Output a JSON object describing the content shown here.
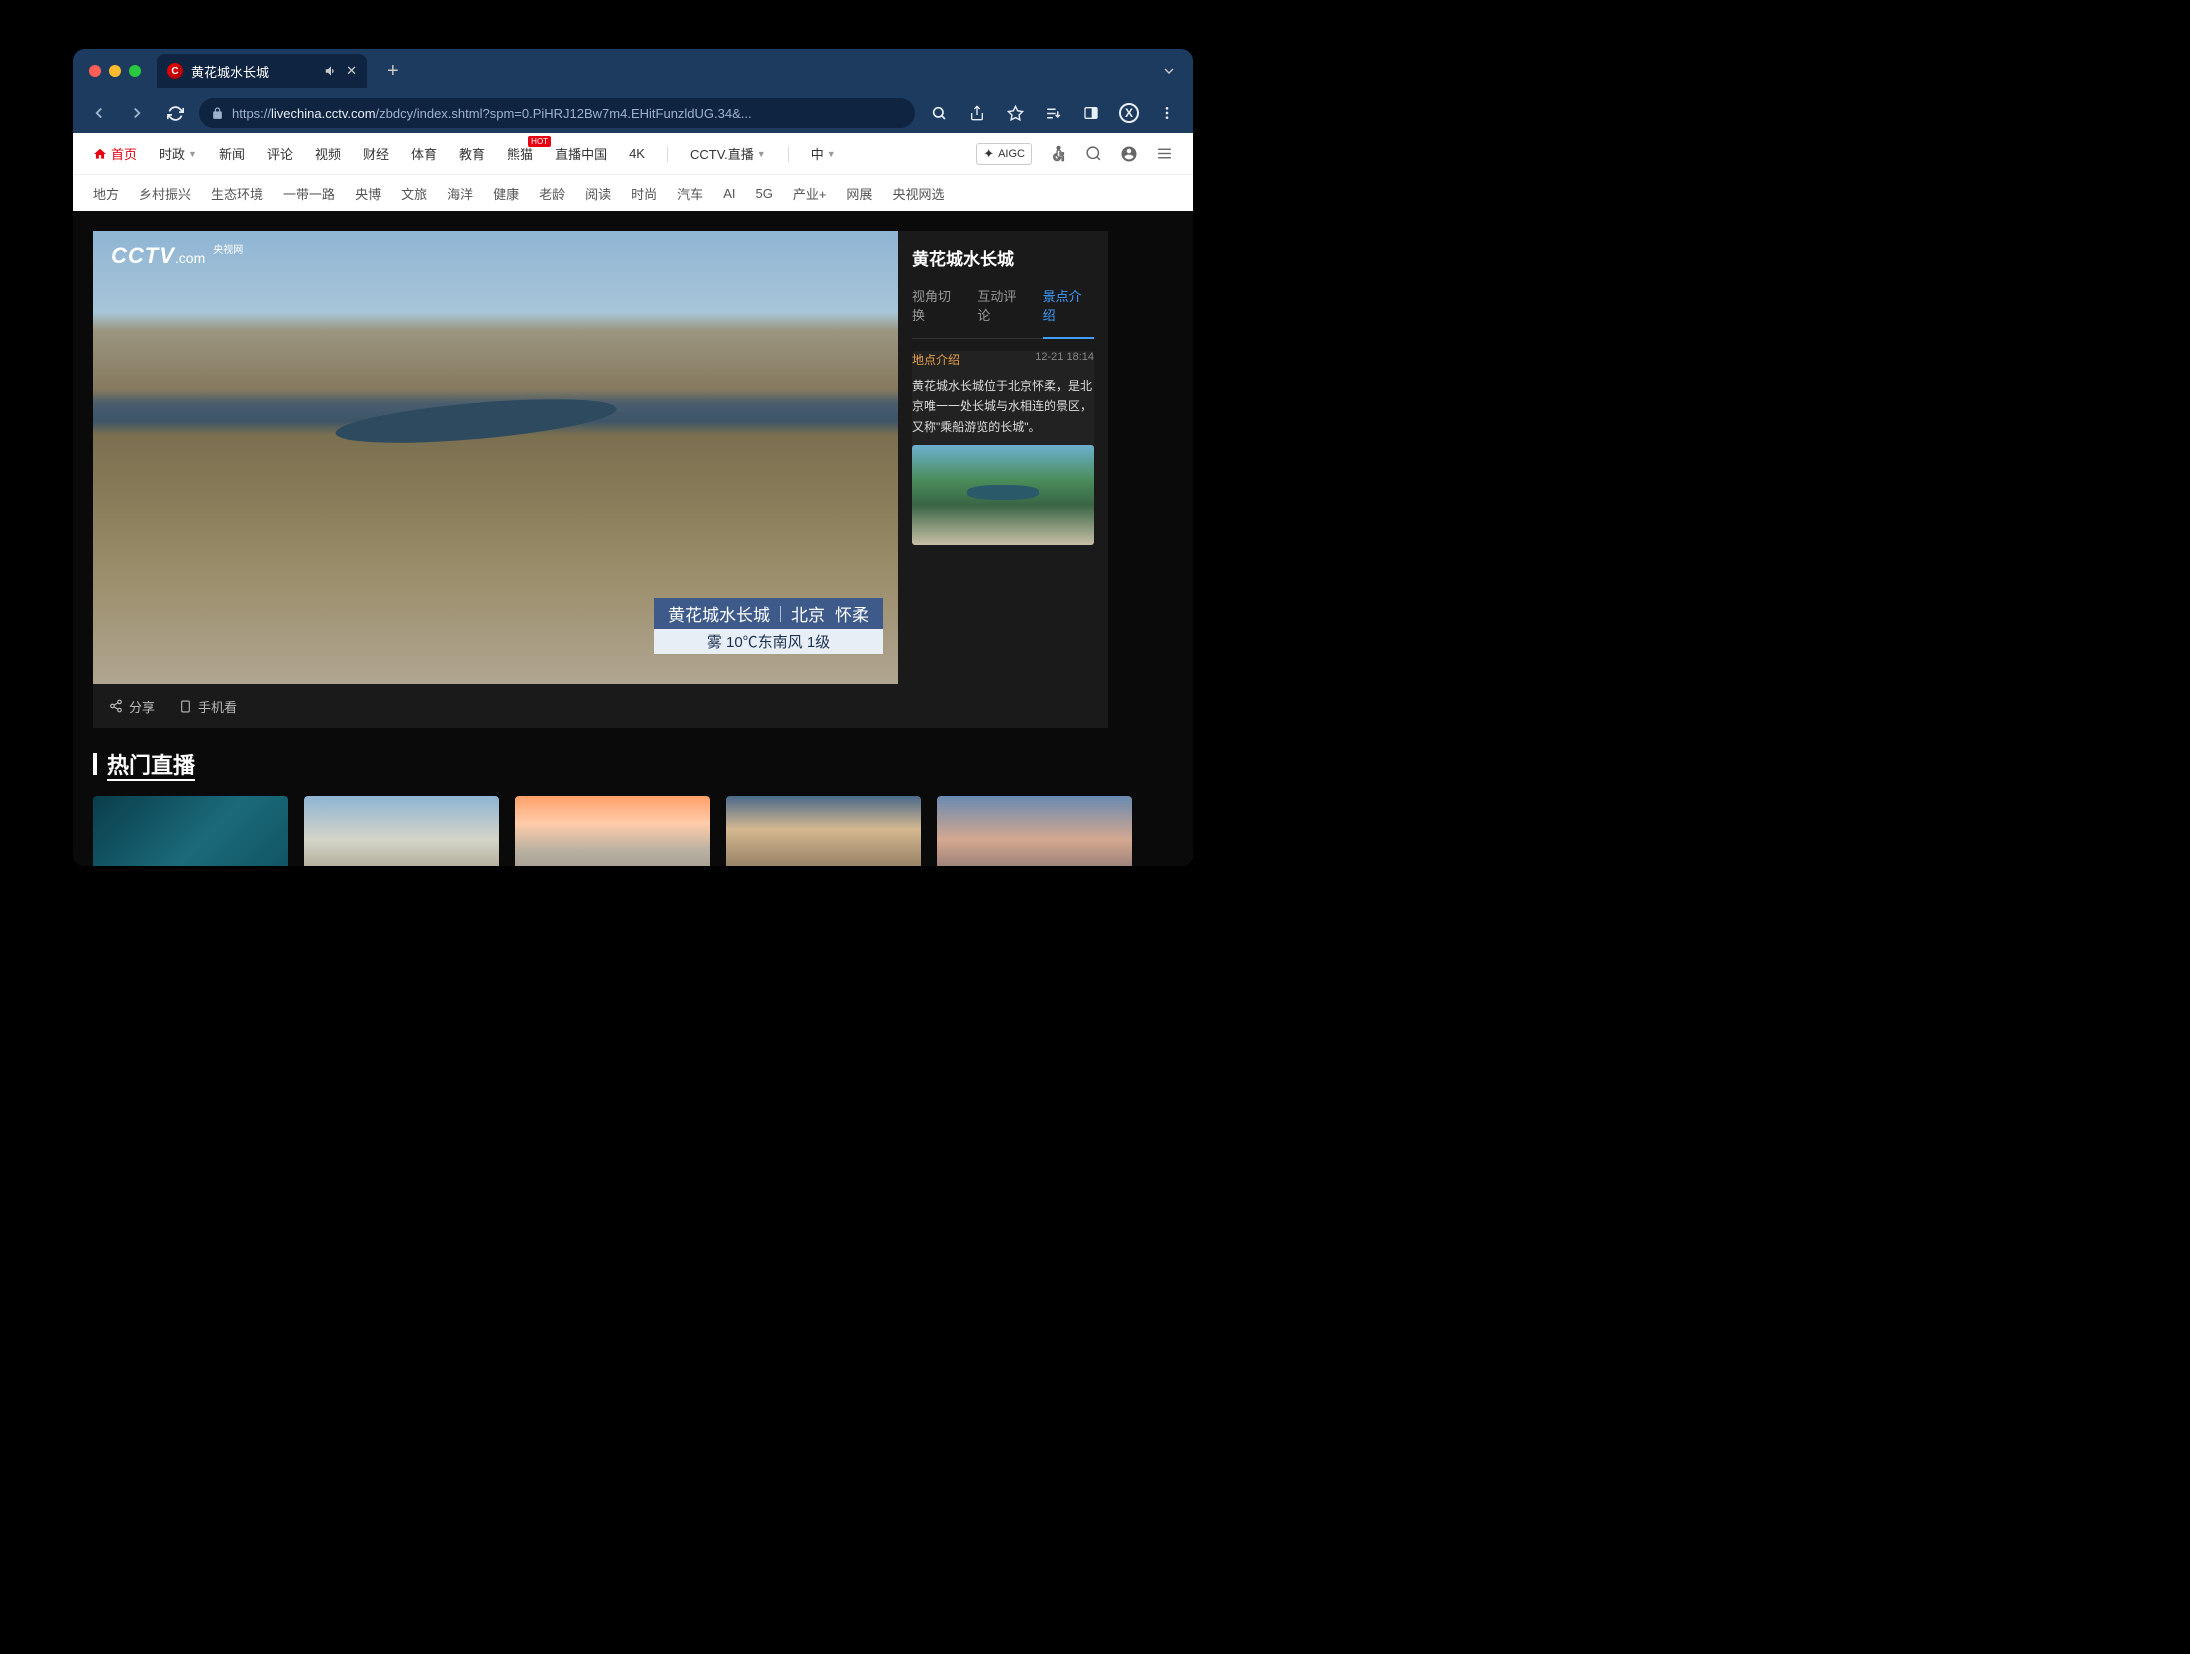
{
  "browser": {
    "tab_title": "黄花城水长城",
    "url_scheme": "https://",
    "url_domain": "livechina.cctv.com",
    "url_path": "/zbdcy/index.shtml?spm=0.PiHRJ12Bw7m4.EHitFunzldUG.34&...",
    "avatar_letter": "X"
  },
  "nav_primary": {
    "home": "首页",
    "items": [
      "时政",
      "新闻",
      "评论",
      "视频",
      "财经",
      "体育",
      "教育",
      "熊猫",
      "直播中国",
      "4K"
    ],
    "hot_on": "熊猫",
    "hot_label": "HOT",
    "cctv_live": "CCTV.直播",
    "lang": "中",
    "aigc": "AIGC"
  },
  "nav_secondary": [
    "地方",
    "乡村振兴",
    "生态环境",
    "一带一路",
    "央博",
    "文旅",
    "海洋",
    "健康",
    "老龄",
    "阅读",
    "时尚",
    "汽车",
    "AI",
    "5G",
    "产业+",
    "网展",
    "央视网选"
  ],
  "video": {
    "logo_main": "CCTV",
    "logo_sub": ".com",
    "logo_cn": "央视网",
    "overlay_name": "黄花城水长城",
    "overlay_city": "北京",
    "overlay_district": "怀柔",
    "overlay_weather": "雾  10℃东南风 1级",
    "share": "分享",
    "mobile": "手机看"
  },
  "side": {
    "title": "黄花城水长城",
    "tabs": [
      "视角切换",
      "互动评论",
      "景点介绍"
    ],
    "active_tab": 2,
    "info_title": "地点介绍",
    "info_time": "12-21 18:14",
    "info_body": "黄花城水长城位于北京怀柔，是北京唯一一处长城与水相连的景区，又称\"乘船游览的长城\"。"
  },
  "hot": {
    "title": "热门直播"
  }
}
